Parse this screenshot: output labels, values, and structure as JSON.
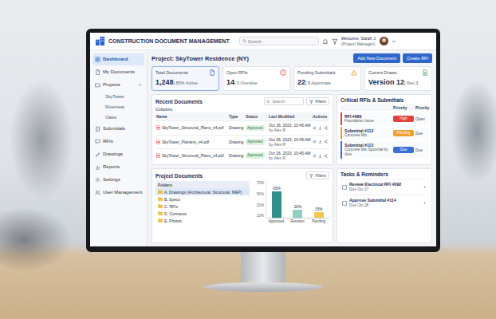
{
  "header": {
    "title": "CONSTRUCTION DOCUMENT MANAGEMENT",
    "search_placeholder": "Search",
    "welcome": "Welcome, Sarah J.",
    "role": "(Project Manager)"
  },
  "sidebar": {
    "items": [
      {
        "label": "Dashboard",
        "selected": true,
        "expanded": false,
        "children": []
      },
      {
        "label": "My Documents",
        "selected": false,
        "expanded": false,
        "children": []
      },
      {
        "label": "Projects",
        "selected": false,
        "expanded": true,
        "children": [
          {
            "label": "SkyTower",
            "selected": false
          },
          {
            "label": "Riverview",
            "selected": false
          },
          {
            "label": "Oasis",
            "selected": false
          }
        ]
      },
      {
        "label": "Submittals",
        "selected": false,
        "expanded": false,
        "children": []
      },
      {
        "label": "RFIs",
        "selected": false,
        "expanded": false,
        "children": []
      },
      {
        "label": "Drawings",
        "selected": false,
        "expanded": false,
        "children": []
      },
      {
        "label": "Reports",
        "selected": false,
        "expanded": false,
        "children": []
      },
      {
        "label": "Settings",
        "selected": false,
        "expanded": false,
        "children": []
      },
      {
        "label": "User Management",
        "selected": false,
        "expanded": false,
        "children": []
      }
    ]
  },
  "project": {
    "title": "Project: SkyTower Residence (NY)",
    "buttons": [
      "Add New Document",
      "Create RFI"
    ]
  },
  "stats": [
    {
      "label": "Total Documents",
      "value": "1,248",
      "detail": "| 85% Active",
      "color": "#3b6fd4",
      "selected": true
    },
    {
      "label": "Open RFIs",
      "value": "14",
      "detail": "| 0 Overdue",
      "color": "#e0413a",
      "selected": false
    },
    {
      "label": "Pending Submittals",
      "value": "22",
      "detail": "| 8 Approvals",
      "color": "#e6a91e",
      "selected": false
    },
    {
      "label": "Current Draws",
      "value": "Version 12",
      "detail": "| Rev 3",
      "color": "#3a9a5b",
      "selected": false
    }
  ],
  "recent_documents": {
    "title": "Recent Documents",
    "search_placeholder": "Search",
    "filter": "Filters",
    "columns_label": "Columns",
    "columns": [
      "Name",
      "Type",
      "Status",
      "Last Modified",
      "Actions"
    ],
    "rows": [
      {
        "name": "SkyTower_Structural_Plans_v4.pdf",
        "type": "Drawing",
        "status": "Approved",
        "modified": "Oct 26, 2023, 10:45 AM",
        "by": "by Alex R"
      },
      {
        "name": "SkyTower_Planters_v4.pdf",
        "type": "Drawing",
        "status": "Approved",
        "modified": "Oct 26, 2023, 10:45 AM",
        "by": "by Alex R"
      },
      {
        "name": "SkyTower_Structural_Plans_v4.pdf",
        "type": "Drawing",
        "status": "Approved",
        "modified": "Oct 26, 2023, 10:45 AM",
        "by": "by Alex R"
      }
    ]
  },
  "critical": {
    "title": "Critical RFIs & Submittals",
    "columns": [
      "Priority",
      "Priority"
    ],
    "items": [
      {
        "id": "RFI #089",
        "subject": "Foundation Issue",
        "badge": "High",
        "state": "Open",
        "color": "#e0413a"
      },
      {
        "id": "Submittal #112",
        "subject": "Concrete Mix",
        "badge": "Pending",
        "state": "Due",
        "color": "#f0a030"
      },
      {
        "id": "Submittal #112",
        "subject": "Concrete Mix Spoonial by Alex",
        "badge": "Due",
        "state": "Due",
        "color": "#3b6fd4"
      }
    ]
  },
  "project_documents": {
    "title": "Project Documents",
    "filter": "Filters",
    "folders_label": "Folders",
    "folders": [
      {
        "label": "A. Drawings (Architectural, Structural, MEP)",
        "selected": true
      },
      {
        "label": "B. Specs",
        "selected": false
      },
      {
        "label": "C. RFIs",
        "selected": false
      },
      {
        "label": "D. Contracts",
        "selected": false
      },
      {
        "label": "E. Photos",
        "selected": false
      }
    ],
    "chart": {
      "ticks": [
        "70%",
        "50%",
        "20%",
        "10%"
      ],
      "bars": [
        {
          "label": "Approved",
          "value_label": "65%",
          "value": 65,
          "color": "#2f8f8a"
        },
        {
          "label": "Revision",
          "value_label": "20%",
          "value": 20,
          "color": "#8fcfc4"
        },
        {
          "label": "Pending",
          "value_label": "15%",
          "value": 15,
          "color": "#f2c94c"
        }
      ]
    }
  },
  "tasks": {
    "title": "Tasks & Reminders",
    "items": [
      {
        "title": "Review Electrical RFI #092",
        "due": "Due Oct 27",
        "checked": false
      },
      {
        "title": "Approve Submittal #114",
        "due": "Due Oct 28",
        "checked": false
      }
    ]
  }
}
